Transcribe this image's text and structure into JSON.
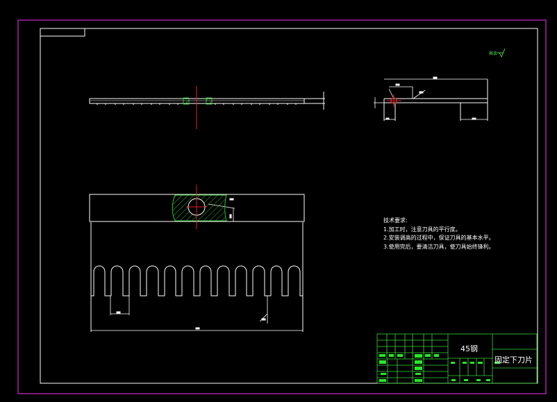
{
  "colors": {
    "background": "#000000",
    "outer_border": "#d02ad0",
    "line": "#ffffff",
    "centerline": "#e0202a",
    "hatch": "#29c529",
    "dimension": "#ffffff",
    "titleblock_line": "#39d839",
    "titleblock_fill": "#29e629"
  },
  "tech_notes": {
    "title": "技术要求:",
    "items": [
      "1.加工时，注意刀具的平行度。",
      "2.安装调高的过程中，保证刀具的基本水平。",
      "3.使用完后，要清洁刀具，使刀具始终锋利。"
    ]
  },
  "title_block": {
    "material": "45钢",
    "part_name": "固定下刀片"
  },
  "roughness_note": "其余"
}
